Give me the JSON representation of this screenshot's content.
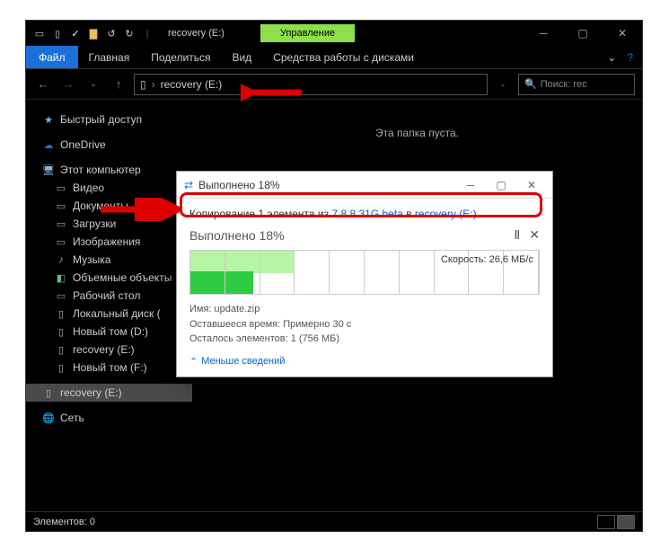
{
  "titlebar": {
    "title": "recovery (E:)",
    "context_tab": "Управление"
  },
  "ribbon": {
    "file": "Файл",
    "tabs": [
      "Главная",
      "Поделиться",
      "Вид"
    ],
    "context": "Средства работы с дисками"
  },
  "address": {
    "path": "recovery (E:)",
    "search_placeholder": "Поиск: rec"
  },
  "sidebar": {
    "quick": "Быстрый доступ",
    "onedrive": "OneDrive",
    "pc": "Этот компьютер",
    "items": [
      "Видео",
      "Документы",
      "Загрузки",
      "Изображения",
      "Музыка",
      "Объемные объекты",
      "Рабочий стол",
      "Локальный диск (",
      "Новый том (D:)",
      "recovery (E:)",
      "Новый том (F:)"
    ],
    "selected": "recovery (E:)",
    "network": "Сеть"
  },
  "content": {
    "empty": "Эта папка пуста."
  },
  "status": {
    "elements": "Элементов: 0"
  },
  "dialog": {
    "title": "Выполнено 18%",
    "copy_prefix": "Копирование 1 элемента из ",
    "copy_src": "7.8.8.31G beta",
    "copy_mid": " в ",
    "copy_dst": "recovery (E:)",
    "progress_label": "Выполнено 18%",
    "speed": "Скорость: 26,6 МБ/с",
    "name_label": "Имя:",
    "name_value": "update.zip",
    "remaining_label": "Оставшееся время:",
    "remaining_value": "Примерно 30 с",
    "items_left_label": "Осталось элементов:",
    "items_left_value": "1 (756 МБ)",
    "fewer": "Меньше сведений"
  }
}
